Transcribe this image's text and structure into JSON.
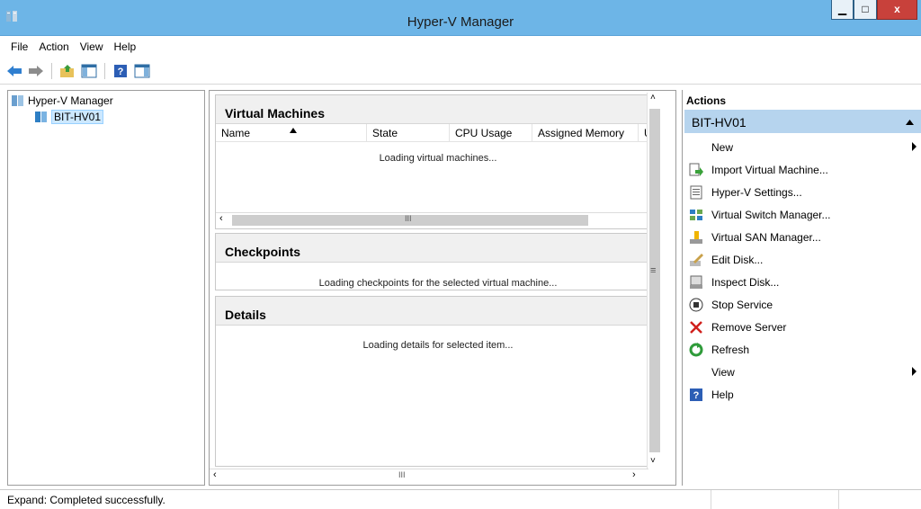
{
  "window": {
    "title": "Hyper-V Manager",
    "minimize_icon": "minimize-icon",
    "maximize_icon": "maximize-icon",
    "close_icon": "close-icon"
  },
  "menu": {
    "items": [
      "File",
      "Action",
      "View",
      "Help"
    ]
  },
  "toolbar": {
    "icons": [
      "back-arrow-icon",
      "forward-arrow-icon",
      "up-folder-icon",
      "show-hide-tree-icon",
      "help-icon",
      "show-hide-action-pane-icon"
    ]
  },
  "tree": {
    "root_label": "Hyper-V Manager",
    "server_label": "BIT-HV01"
  },
  "center": {
    "vm_section": {
      "title": "Virtual Machines",
      "columns": [
        "Name",
        "State",
        "CPU Usage",
        "Assigned Memory",
        "U"
      ],
      "message": "Loading virtual machines..."
    },
    "checkpoints_section": {
      "title": "Checkpoints",
      "message": "Loading checkpoints for the selected virtual machine..."
    },
    "details_section": {
      "title": "Details",
      "message": "Loading details for selected item..."
    },
    "scroll_glyph": "III",
    "grip_glyph": "≡"
  },
  "actions": {
    "header": "Actions",
    "section_title": "BIT-HV01",
    "items": [
      {
        "label": "New",
        "icon": "none",
        "submenu": true
      },
      {
        "label": "Import Virtual Machine...",
        "icon": "import-vm-icon"
      },
      {
        "label": "Hyper-V Settings...",
        "icon": "settings-icon"
      },
      {
        "label": "Virtual Switch Manager...",
        "icon": "switch-icon"
      },
      {
        "label": "Virtual SAN Manager...",
        "icon": "san-icon"
      },
      {
        "label": "Edit Disk...",
        "icon": "edit-disk-icon"
      },
      {
        "label": "Inspect Disk...",
        "icon": "inspect-disk-icon"
      },
      {
        "label": "Stop Service",
        "icon": "stop-icon"
      },
      {
        "label": "Remove Server",
        "icon": "remove-icon"
      },
      {
        "label": "Refresh",
        "icon": "refresh-icon"
      },
      {
        "label": "View",
        "icon": "none",
        "submenu": true
      },
      {
        "label": "Help",
        "icon": "help-icon"
      }
    ]
  },
  "status": {
    "text": "Expand: Completed successfully."
  },
  "colors": {
    "titlebar": "#6db5e7",
    "close": "#c8413b",
    "actions_section": "#b6d4ee",
    "section_header": "#f0f0f0"
  }
}
